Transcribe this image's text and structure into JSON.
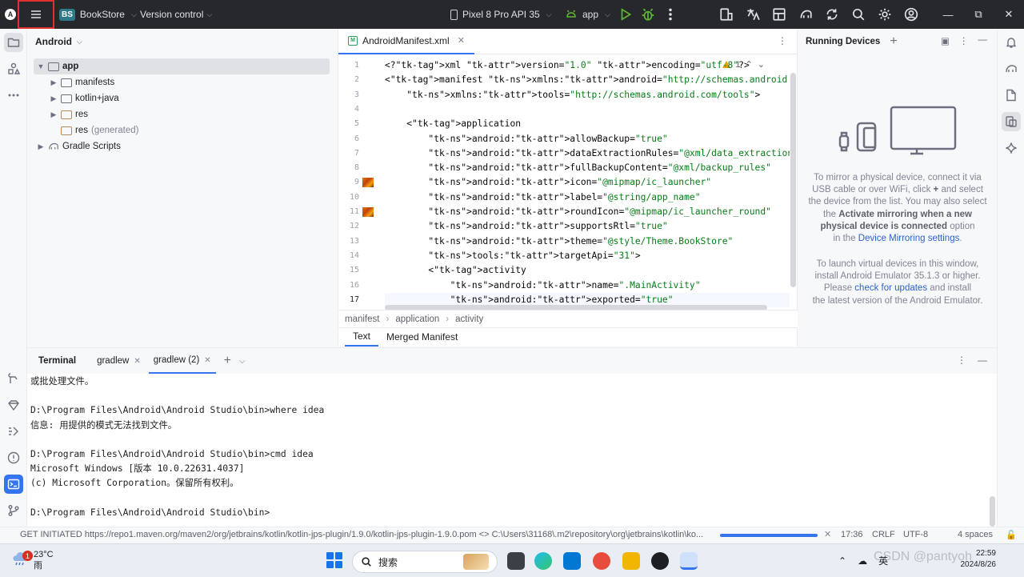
{
  "titlebar": {
    "app_logo": "A",
    "project_badge": "BS",
    "project_name": "BookStore",
    "vcs": "Version control",
    "device": "Pixel 8 Pro API 35",
    "run_config": "app"
  },
  "project_panel": {
    "view": "Android",
    "tree": [
      {
        "label": "app",
        "level": 0,
        "expanded": true
      },
      {
        "label": "manifests",
        "level": 1
      },
      {
        "label": "kotlin+java",
        "level": 1
      },
      {
        "label": "res",
        "level": 1
      },
      {
        "label": "res",
        "suffix": "(generated)",
        "level": 1
      },
      {
        "label": "Gradle Scripts",
        "level": 0
      }
    ]
  },
  "editor": {
    "tab": "AndroidManifest.xml",
    "warnings": "1",
    "current_line": 17,
    "lines": [
      {
        "n": "1",
        "code": "<?xml version=\"1.0\" encoding=\"utf-8\"?>"
      },
      {
        "n": "2",
        "code": "<manifest xmlns:android=\"http://schemas.android.com/apk/res/android\""
      },
      {
        "n": "3",
        "code": "    xmlns:tools=\"http://schemas.android.com/tools\">"
      },
      {
        "n": "4",
        "code": ""
      },
      {
        "n": "5",
        "code": "    <application"
      },
      {
        "n": "6",
        "code": "        android:allowBackup=\"true\""
      },
      {
        "n": "7",
        "code": "        android:dataExtractionRules=\"@xml/data_extraction_rules\""
      },
      {
        "n": "8",
        "code": "        android:fullBackupContent=\"@xml/backup_rules\""
      },
      {
        "n": "9",
        "code": "        android:icon=\"@mipmap/ic_launcher\""
      },
      {
        "n": "10",
        "code": "        android:label=\"@string/app_name\""
      },
      {
        "n": "11",
        "code": "        android:roundIcon=\"@mipmap/ic_launcher_round\""
      },
      {
        "n": "12",
        "code": "        android:supportsRtl=\"true\""
      },
      {
        "n": "13",
        "code": "        android:theme=\"@style/Theme.BookStore\""
      },
      {
        "n": "14",
        "code": "        tools:targetApi=\"31\">"
      },
      {
        "n": "15",
        "code": "        <activity"
      },
      {
        "n": "16",
        "code": "            android:name=\".MainActivity\""
      },
      {
        "n": "17",
        "code": "            android:exported=\"true\""
      }
    ],
    "breadcrumbs": [
      "manifest",
      "application",
      "activity"
    ],
    "bottom_tabs": [
      "Text",
      "Merged Manifest"
    ]
  },
  "running_devices": {
    "title": "Running Devices",
    "mirror_text": {
      "l1": "To mirror a physical device, connect it via",
      "l2a": "USB cable or over WiFi, click",
      "l2b": "and select",
      "l3": "the device from the list. You may also select",
      "l4a": "the",
      "l4b": "Activate mirroring when a new",
      "l5a": "physical device is connected",
      "l5b": "option",
      "l6a": "in the",
      "l6b": "Device Mirroring settings",
      "l6c": "."
    },
    "emulator_text": {
      "l1": "To launch virtual devices in this window,",
      "l2": "install Android Emulator 35.1.3 or higher.",
      "l3a": "Please",
      "l3b": "check for updates",
      "l3c": "and install",
      "l4": "the latest version of the Android Emulator."
    }
  },
  "terminal": {
    "title": "Terminal",
    "tabs": [
      "gradlew",
      "gradlew (2)"
    ],
    "lines": [
      "或批处理文件。",
      "",
      "D:\\Program Files\\Android\\Android Studio\\bin>where idea",
      "信息: 用提供的模式无法找到文件。",
      "",
      "D:\\Program Files\\Android\\Android Studio\\bin>cmd idea",
      "Microsoft Windows [版本 10.0.22631.4037]",
      "(c) Microsoft Corporation。保留所有权利。",
      "",
      "D:\\Program Files\\Android\\Android Studio\\bin>"
    ]
  },
  "statusbar": {
    "message": "GET INITIATED https://repo1.maven.org/maven2/org/jetbrains/kotlin/kotlin-jps-plugin/1.9.0/kotlin-jps-plugin-1.9.0.pom <> C:\\Users\\31168\\.m2\\repository\\org\\jetbrains\\kotlin\\ko...",
    "position": "17:36",
    "line_sep": "CRLF",
    "encoding": "UTF-8",
    "indent": "4 spaces"
  },
  "taskbar": {
    "weather_temp": "23°C",
    "weather_desc": "雨",
    "weather_badge": "1",
    "search": "搜索",
    "ime": "英",
    "time": "22:59",
    "date": "2024/8/26"
  },
  "watermark": "CSDN @pantyoh",
  "colors": {
    "accent": "#3574f0",
    "titlebar_bg": "#27282c",
    "highlight_box": "#e03030"
  }
}
